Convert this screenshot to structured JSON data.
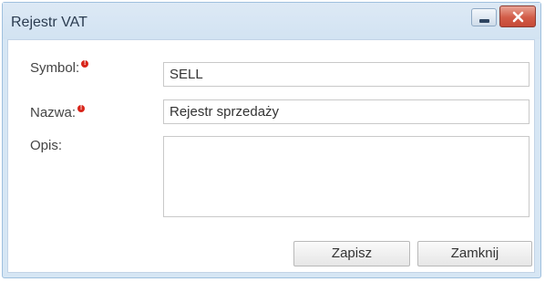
{
  "window": {
    "title": "Rejestr VAT",
    "minimize_icon": "minimize-icon",
    "close_icon": "close-icon",
    "close_color": "#d25d48"
  },
  "form": {
    "symbol_label": "Symbol:",
    "symbol_value": "SELL",
    "symbol_required_icon": "required-icon",
    "nazwa_label": "Nazwa:",
    "nazwa_value": "Rejestr sprzedaży",
    "nazwa_required_icon": "required-icon",
    "opis_label": "Opis:",
    "opis_value": ""
  },
  "buttons": {
    "save_label": "Zapisz",
    "close_label": "Zamknij"
  }
}
